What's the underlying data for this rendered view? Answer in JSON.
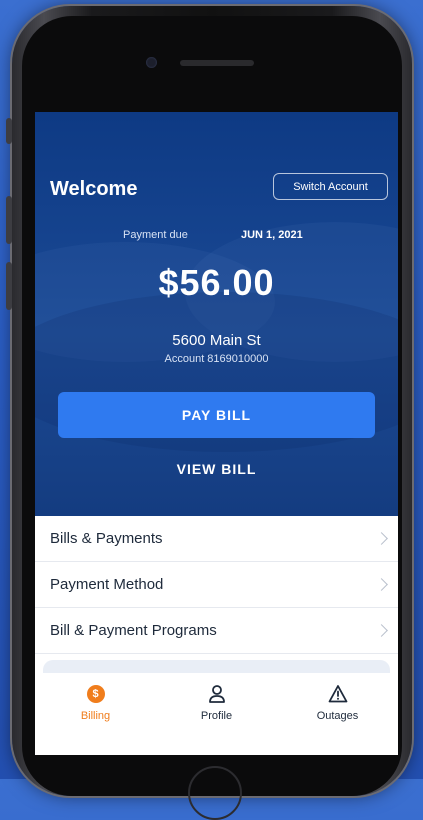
{
  "header": {
    "title": "Welcome",
    "switch_account_label": "Switch Account"
  },
  "bill": {
    "due_label": "Payment due",
    "due_date": "JUN 1, 2021",
    "amount": "$56.00",
    "address": "5600 Main St",
    "account": "Account 8169010000",
    "pay_label": "PAY BILL",
    "view_label": "VIEW BILL"
  },
  "menu": {
    "items": [
      {
        "label": "Bills & Payments"
      },
      {
        "label": "Payment Method"
      },
      {
        "label": "Bill & Payment Programs"
      }
    ]
  },
  "tabs": [
    {
      "label": "Billing",
      "icon": "dollar-icon",
      "active": true,
      "glyph": "$"
    },
    {
      "label": "Profile",
      "icon": "user-icon",
      "active": false
    },
    {
      "label": "Outages",
      "icon": "warning-icon",
      "active": false
    }
  ],
  "colors": {
    "hero": "#16448f",
    "accent_button": "#2f7af0",
    "active_tab": "#f07d1c"
  }
}
